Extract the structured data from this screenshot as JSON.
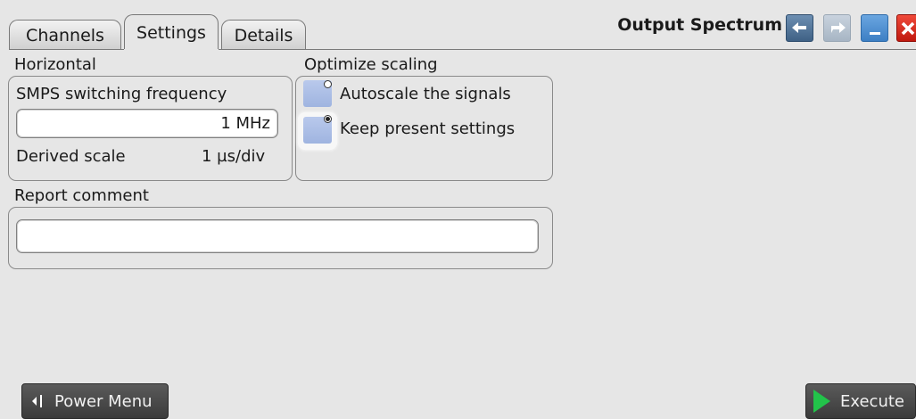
{
  "tabs": [
    {
      "label": "Channels"
    },
    {
      "label": "Settings"
    },
    {
      "label": "Details"
    }
  ],
  "active_tab": "Settings",
  "dialog": {
    "title": "Output Spectrum",
    "icons": [
      "undo-icon",
      "redo-icon",
      "minimize-icon",
      "close-icon"
    ]
  },
  "horizontal": {
    "heading": "Horizontal",
    "frequency_label": "SMPS switching frequency",
    "frequency_value": "1 MHz",
    "derived_label": "Derived scale",
    "derived_value": "1 µs/div"
  },
  "optimize": {
    "heading": "Optimize scaling",
    "options": [
      {
        "label": "Autoscale the signals",
        "selected": false
      },
      {
        "label": "Keep present settings",
        "selected": true
      }
    ]
  },
  "report": {
    "heading": "Report comment",
    "value": ""
  },
  "footer": {
    "power_menu_label": "Power Menu",
    "execute_label": "Execute"
  },
  "colors": {
    "background": "#e6e6e6",
    "execute_arrow": "#22c34a",
    "radio_fill": "#a9bde5",
    "close_button": "#d6281c",
    "undo_button": "#4d6f94",
    "minimize_button": "#4a8ed3"
  }
}
